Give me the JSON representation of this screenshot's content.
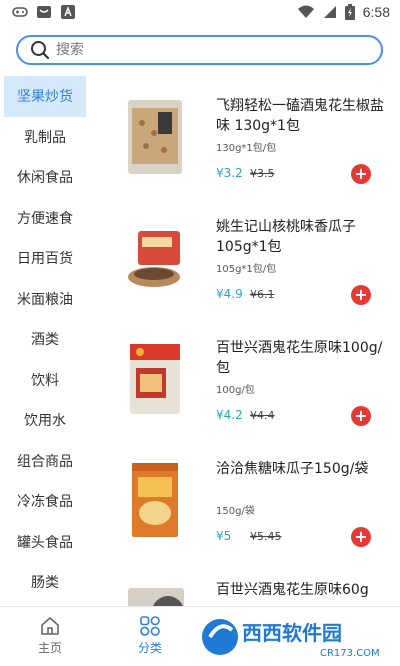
{
  "status_bar": {
    "time": "6:58",
    "icons": [
      "game-controller-icon",
      "app-icon",
      "text-a-icon",
      "wifi-icon",
      "signal-icon",
      "battery-icon"
    ]
  },
  "search": {
    "placeholder": "搜索"
  },
  "sidebar": {
    "items": [
      {
        "label": "坚果炒货",
        "active": true
      },
      {
        "label": "乳制品"
      },
      {
        "label": "休闲食品"
      },
      {
        "label": "方便速食"
      },
      {
        "label": "日用百货"
      },
      {
        "label": "米面粮油"
      },
      {
        "label": "酒类"
      },
      {
        "label": "饮料"
      },
      {
        "label": "饮用水"
      },
      {
        "label": "组合商品"
      },
      {
        "label": "冷冻食品"
      },
      {
        "label": "罐头食品"
      },
      {
        "label": "肠类"
      }
    ]
  },
  "products": [
    {
      "name": "飞翔轻松一磕酒鬼花生椒盐味 130g*1包",
      "spec": "130g*1包/包",
      "price": "¥3.2",
      "orig": "¥3.5"
    },
    {
      "name": "姚生记山核桃味香瓜子105g*1包",
      "spec": "105g*1包/包",
      "price": "¥4.9",
      "orig": "¥6.1"
    },
    {
      "name": "百世兴酒鬼花生原味100g/包",
      "spec": "100g/包",
      "price": "¥4.2",
      "orig": "¥4.4"
    },
    {
      "name": "洽洽焦糖味瓜子150g/袋",
      "spec": "150g/袋",
      "price": "¥5",
      "orig": "¥5.45"
    },
    {
      "name": "百世兴酒鬼花生原味60g",
      "spec": "",
      "price": "",
      "orig": ""
    }
  ],
  "add_label": "+",
  "bottom_nav": {
    "home": "主页",
    "category": "分类"
  },
  "colors": {
    "accent": "#2f80d8",
    "price": "#2aa8b8",
    "add_button": "#e53935",
    "active_bg": "#d6e9fb"
  },
  "watermark": {
    "text": "西西软件园",
    "url": "CR173.COM"
  }
}
